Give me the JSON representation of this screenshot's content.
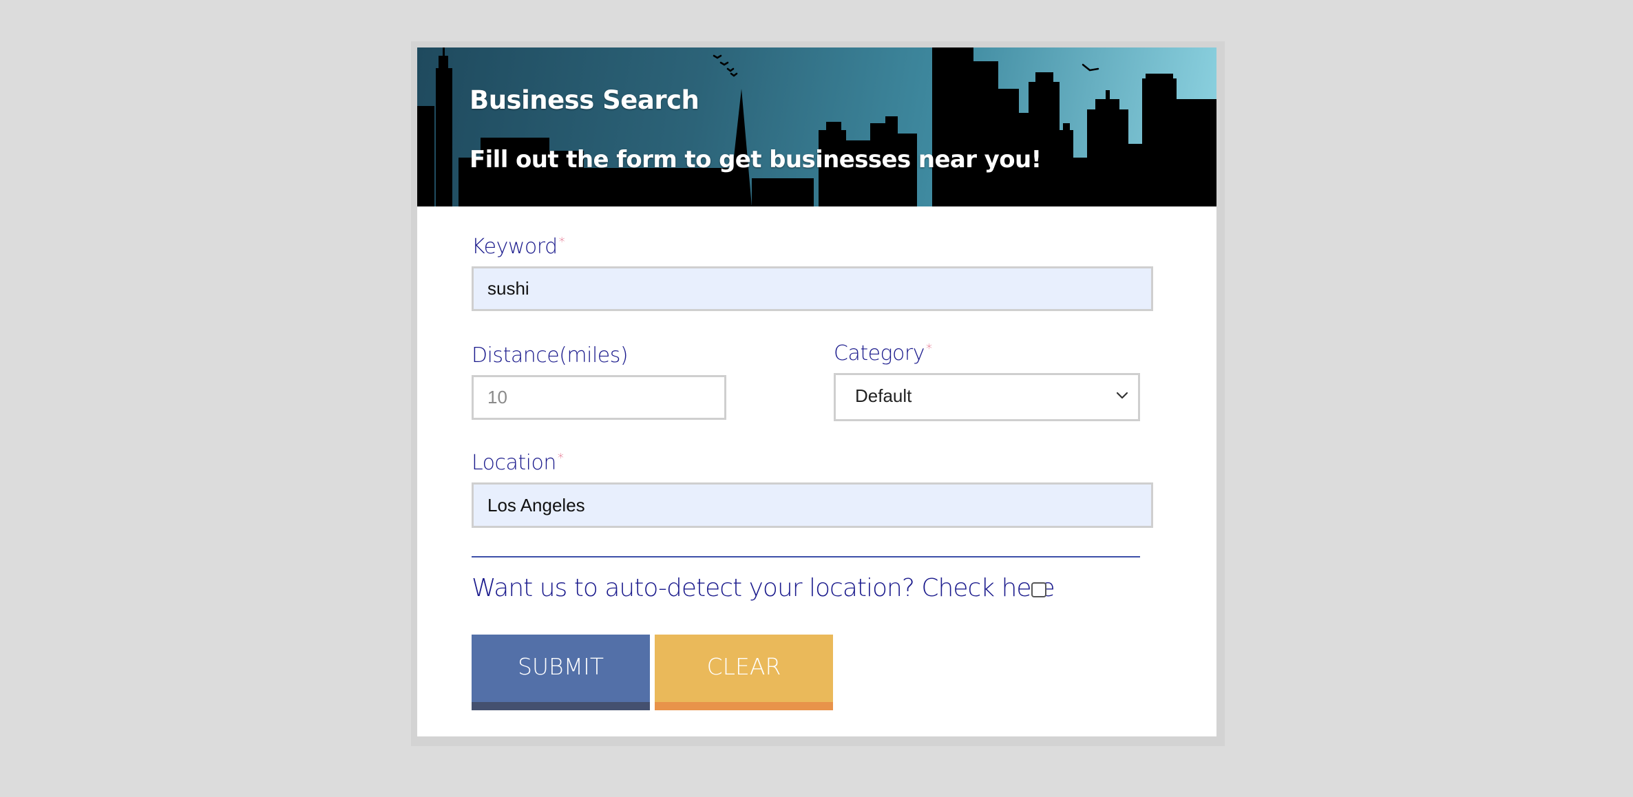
{
  "header": {
    "title": "Business Search",
    "subtitle": "Fill out the form to get businesses near you!"
  },
  "form": {
    "keyword": {
      "label": "Keyword",
      "required_mark": "*",
      "value": "sushi"
    },
    "distance": {
      "label": "Distance(miles)",
      "placeholder": "10",
      "value": ""
    },
    "category": {
      "label": "Category",
      "required_mark": "*",
      "selected": "Default"
    },
    "location": {
      "label": "Location",
      "required_mark": "*",
      "value": "Los Angeles"
    },
    "autodetect": {
      "text": "Want us to auto-detect your location? Check here",
      "checked": false
    },
    "buttons": {
      "submit_label": "SUBMIT",
      "clear_label": "CLEAR"
    }
  },
  "colors": {
    "label": "#1a1a8c",
    "required": "#e0607e",
    "submit": "#5370a8",
    "clear": "#eab95a",
    "input_filled_bg": "#e8effd"
  },
  "icons": {
    "select_arrow": "chevron-down-icon",
    "banner_image": "city-skyline"
  }
}
